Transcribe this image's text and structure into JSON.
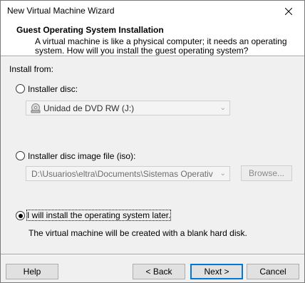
{
  "window": {
    "title": "New Virtual Machine Wizard",
    "close_icon": "close-icon"
  },
  "header": {
    "title": "Guest Operating System Installation",
    "description": "A virtual machine is like a physical computer; it needs an operating system. How will you install the guest operating system?"
  },
  "install_from": {
    "label": "Install from:",
    "options": [
      {
        "label": "Installer disc:",
        "selected": false,
        "dropdown_value": "Unidad de DVD RW (J:)",
        "dropdown_icon": "dvd-drive-icon"
      },
      {
        "label": "Installer disc image file (iso):",
        "selected": false,
        "path_value": "D:\\Usuarios\\eltra\\Documents\\Sistemas Operativos\\Wir",
        "browse_label": "Browse..."
      },
      {
        "label": "I will install the operating system later.",
        "selected": true,
        "note": "The virtual machine will be created with a blank hard disk."
      }
    ]
  },
  "footer": {
    "help": "Help",
    "back": "< Back",
    "next": "Next >",
    "cancel": "Cancel"
  }
}
